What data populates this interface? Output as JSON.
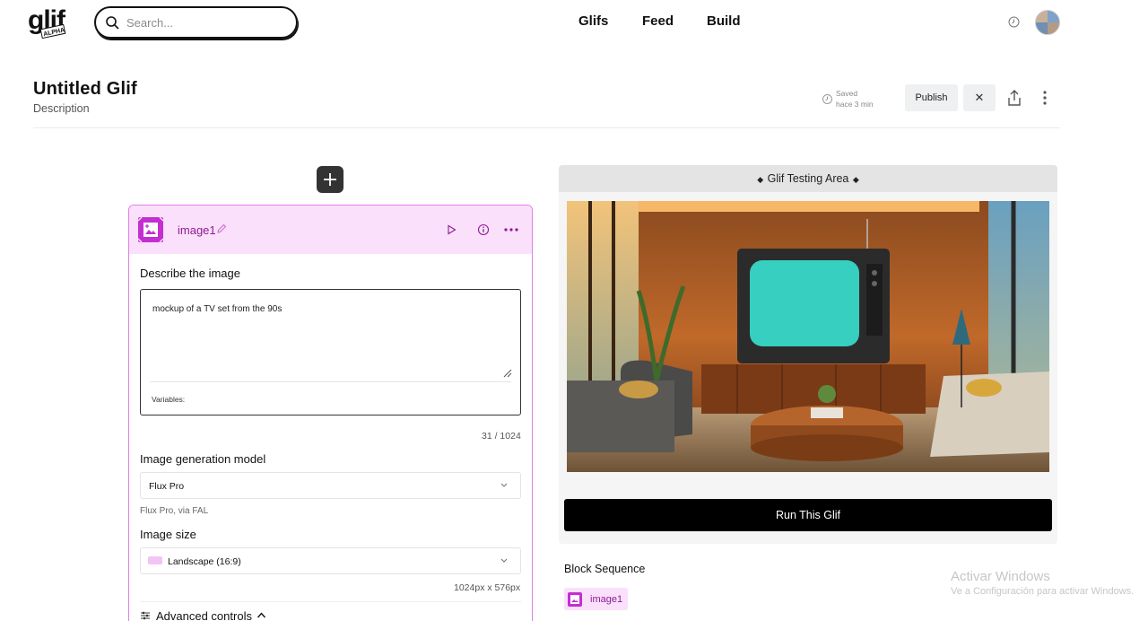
{
  "header": {
    "logo_text": "glif",
    "logo_badge": "ALPHA",
    "search_placeholder": "Search...",
    "nav": [
      "Glifs",
      "Feed",
      "Build"
    ]
  },
  "glif": {
    "title": "Untitled Glif",
    "description": "Description",
    "saved_label": "Saved",
    "saved_time": "hace 3 min",
    "publish_label": "Publish",
    "close_label": "✕"
  },
  "block": {
    "name": "image1",
    "describe_label": "Describe the image",
    "prompt": "mockup of a TV set from the 90s",
    "variables_label": "Variables:",
    "char_count": "31 / 1024",
    "model_label": "Image generation model",
    "model_value": "Flux Pro",
    "model_hint": "Flux Pro, via FAL",
    "size_label": "Image size",
    "size_value": "Landscape (16:9)",
    "size_dims": "1024px x 576px",
    "advanced_label": "Advanced controls",
    "accent_color": "#e27ee7",
    "head_bg": "#fae0fb"
  },
  "testing": {
    "title": "Glif Testing Area",
    "run_label": "Run This Glif"
  },
  "sequence": {
    "title": "Block Sequence",
    "items": [
      "image1"
    ]
  },
  "watermark": {
    "title": "Activar Windows",
    "subtitle": "Ve a Configuración para activar Windows."
  }
}
